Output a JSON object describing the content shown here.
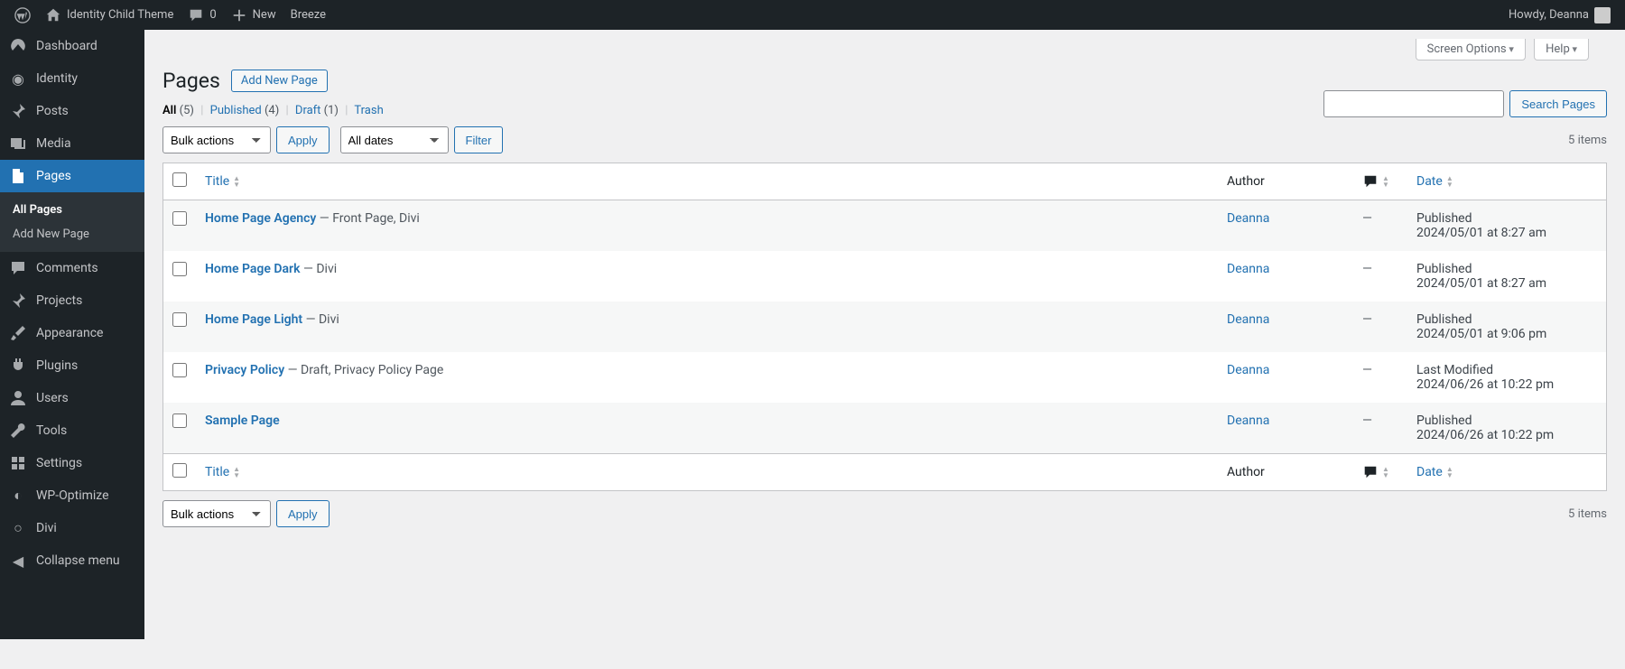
{
  "adminbar": {
    "site_name": "Identity Child Theme",
    "comment_count": "0",
    "new_label": "New",
    "breeze_label": "Breeze",
    "howdy": "Howdy, Deanna"
  },
  "sidebar": {
    "items": [
      {
        "label": "Dashboard",
        "icon": "dashboard-icon"
      },
      {
        "label": "Identity",
        "icon": "identity-icon"
      },
      {
        "label": "Posts",
        "icon": "pin-icon"
      },
      {
        "label": "Media",
        "icon": "media-icon"
      },
      {
        "label": "Pages",
        "icon": "pages-icon",
        "current": true
      },
      {
        "label": "Comments",
        "icon": "comment-icon"
      },
      {
        "label": "Projects",
        "icon": "pin-icon"
      },
      {
        "label": "Appearance",
        "icon": "brush-icon"
      },
      {
        "label": "Plugins",
        "icon": "plugin-icon"
      },
      {
        "label": "Users",
        "icon": "user-icon"
      },
      {
        "label": "Tools",
        "icon": "wrench-icon"
      },
      {
        "label": "Settings",
        "icon": "settings-icon"
      },
      {
        "label": "WP-Optimize",
        "icon": "optimize-icon"
      },
      {
        "label": "Divi",
        "icon": "divi-icon"
      },
      {
        "label": "Collapse menu",
        "icon": "collapse-icon"
      }
    ],
    "submenu": [
      {
        "label": "All Pages",
        "current": true
      },
      {
        "label": "Add New Page"
      }
    ]
  },
  "screen_options": "Screen Options",
  "help": "Help",
  "page_title": "Pages",
  "add_new": "Add New Page",
  "filters": {
    "all_label": "All",
    "all_count": "(5)",
    "published_label": "Published",
    "published_count": "(4)",
    "draft_label": "Draft",
    "draft_count": "(1)",
    "trash_label": "Trash"
  },
  "search": {
    "button": "Search Pages"
  },
  "bulk": {
    "select": "Bulk actions",
    "apply": "Apply"
  },
  "dates": {
    "select": "All dates",
    "filter": "Filter"
  },
  "items_count": "5 items",
  "columns": {
    "title": "Title",
    "author": "Author",
    "date": "Date"
  },
  "rows": [
    {
      "title": "Home Page Agency",
      "suffix": " — Front Page, Divi",
      "author": "Deanna",
      "comments": "—",
      "status": "Published",
      "date": "2024/05/01 at 8:27 am"
    },
    {
      "title": "Home Page Dark",
      "suffix": " — Divi",
      "author": "Deanna",
      "comments": "—",
      "status": "Published",
      "date": "2024/05/01 at 8:27 am"
    },
    {
      "title": "Home Page Light",
      "suffix": " — Divi",
      "author": "Deanna",
      "comments": "—",
      "status": "Published",
      "date": "2024/05/01 at 9:06 pm"
    },
    {
      "title": "Privacy Policy",
      "suffix": " — Draft, Privacy Policy Page",
      "author": "Deanna",
      "comments": "—",
      "status": "Last Modified",
      "date": "2024/06/26 at 10:22 pm"
    },
    {
      "title": "Sample Page",
      "suffix": "",
      "author": "Deanna",
      "comments": "—",
      "status": "Published",
      "date": "2024/06/26 at 10:22 pm"
    }
  ]
}
